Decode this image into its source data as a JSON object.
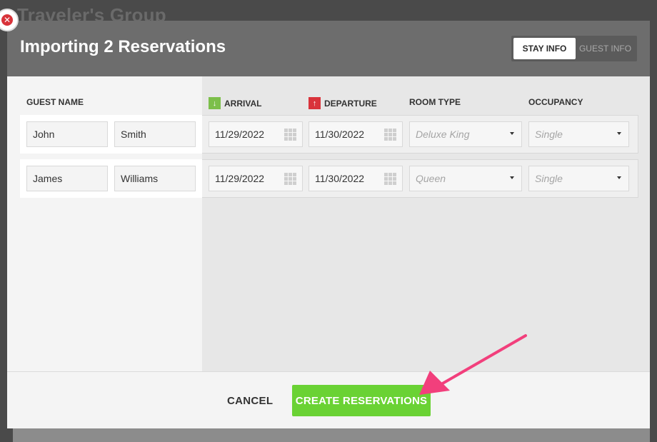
{
  "background": {
    "title": "Traveler's Group"
  },
  "modal": {
    "title": "Importing 2 Reservations",
    "tabs": [
      {
        "label": "STAY INFO",
        "active": true
      },
      {
        "label": "GUEST INFO",
        "active": false
      }
    ]
  },
  "columns": {
    "guest_name": "GUEST NAME",
    "arrival": "ARRIVAL",
    "departure": "DEPARTURE",
    "room_type": "ROOM TYPE",
    "occupancy": "OCCUPANCY"
  },
  "rows": [
    {
      "first": "John",
      "last": "Smith",
      "arrival": "11/29/2022",
      "departure": "11/30/2022",
      "room_type": "Deluxe King",
      "occupancy": "Single"
    },
    {
      "first": "James",
      "last": "Williams",
      "arrival": "11/29/2022",
      "departure": "11/30/2022",
      "room_type": "Queen",
      "occupancy": "Single"
    }
  ],
  "footer": {
    "cancel_label": "CANCEL",
    "create_label": "CREATE RESERVATIONS"
  },
  "icons": {
    "close": "close-icon",
    "arrival": "arrow-down-icon",
    "departure": "arrow-up-icon",
    "calendar": "calendar-grid-icon",
    "dropdown": "chevron-down-icon"
  },
  "colors": {
    "header": "#6d6d6d",
    "primary_button": "#6ad234",
    "arrival_badge": "#7cbf4a",
    "departure_badge": "#d9333b",
    "annotation_arrow": "#f23f7c"
  }
}
